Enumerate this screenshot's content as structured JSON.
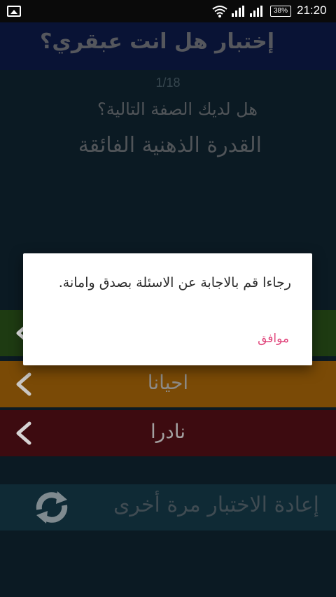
{
  "status_bar": {
    "battery_percent": "38%",
    "time": "21:20",
    "icons": [
      "image-icon",
      "wifi-icon",
      "signal-icon",
      "signal-icon",
      "battery-icon"
    ]
  },
  "app": {
    "title": "إختبار هل انت عبقري؟",
    "title_color": "#091335"
  },
  "quiz": {
    "counter": "1/18",
    "question": "هل لديك الصفة التالية؟",
    "trait": "القدرة الذهنية الفائقة"
  },
  "answers": [
    {
      "label": "",
      "color": "#1e3b12",
      "icon": "chevron-left-icon"
    },
    {
      "label": "احيانا",
      "color": "#7a4a06",
      "icon": "chevron-left-icon"
    },
    {
      "label": "نادرا",
      "color": "#3d0b10",
      "icon": "chevron-left-icon"
    }
  ],
  "retry": {
    "label": "إعادة الاختبار مرة أخرى",
    "icon": "refresh-icon"
  },
  "dialog": {
    "message": "رجاءا قم بالاجابة عن الاسئلة بصدق وامانة.",
    "ok_label": "موافق",
    "accent": "#e0457b"
  }
}
